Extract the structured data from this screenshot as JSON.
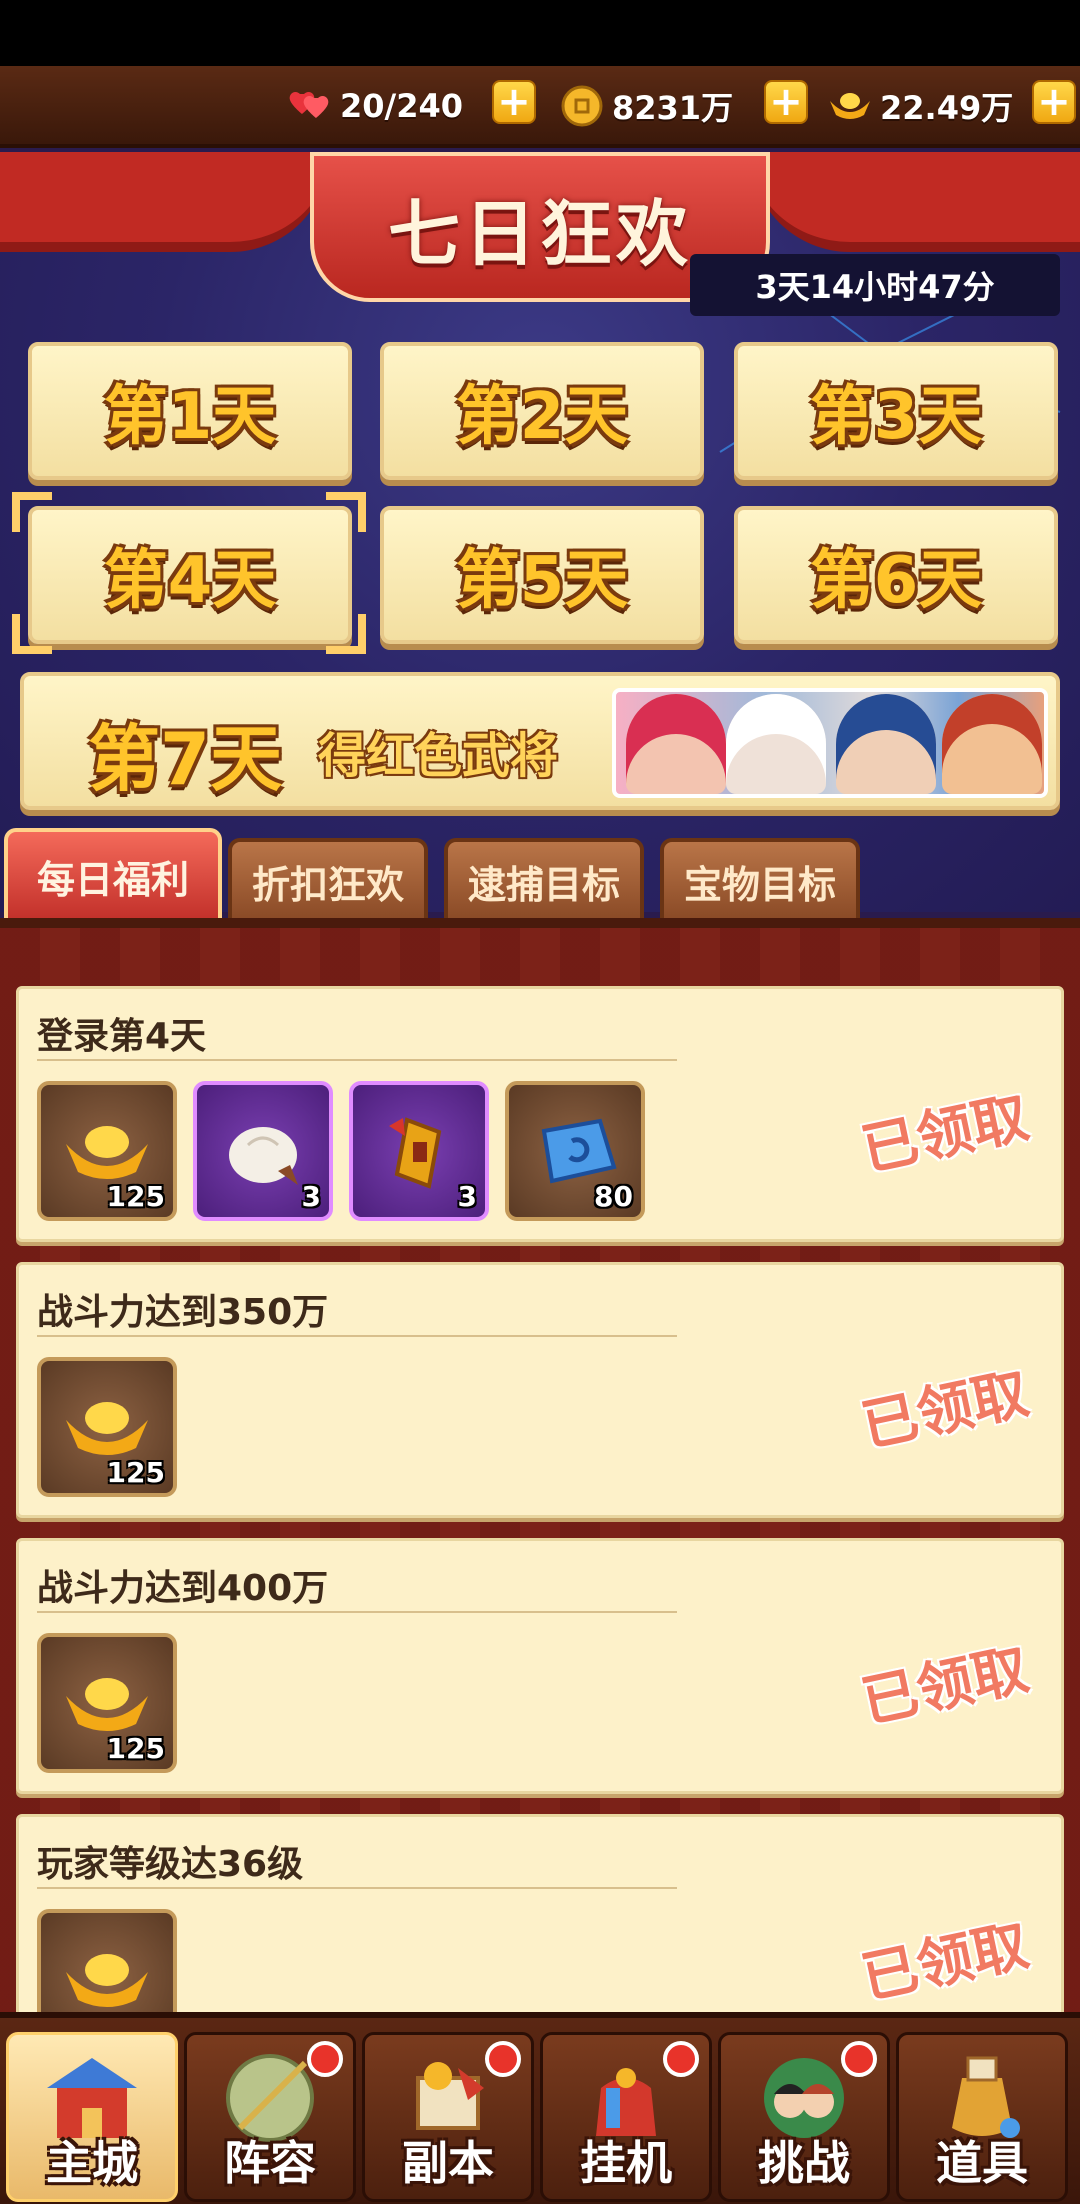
{
  "resources": [
    {
      "icon": "hearts-icon",
      "value": "20/240"
    },
    {
      "icon": "coin-icon",
      "value": "8231万"
    },
    {
      "icon": "ingot-icon",
      "value": "22.49万"
    }
  ],
  "event": {
    "title": "七日狂欢",
    "timer": "3天14小时47分"
  },
  "days": [
    "第1天",
    "第2天",
    "第3天",
    "第4天",
    "第5天",
    "第6天"
  ],
  "selected_day": "第4天",
  "day7": {
    "label": "第7天",
    "desc": "得红色武将"
  },
  "tabs": [
    "每日福利",
    "折扣狂欢",
    "逮捕目标",
    "宝物目标"
  ],
  "active_tab": "每日福利",
  "tasks": [
    {
      "title": "登录第4天",
      "status": "已领取",
      "rewards": [
        {
          "icon": "gold-ingot-icon",
          "count": "125",
          "rarity": "normal"
        },
        {
          "icon": "steamed-bun-icon",
          "count": "3",
          "rarity": "purple"
        },
        {
          "icon": "token-plaque-icon",
          "count": "3",
          "rarity": "purple"
        },
        {
          "icon": "blue-stone-icon",
          "count": "80",
          "rarity": "normal"
        }
      ]
    },
    {
      "title": "战斗力达到350万",
      "status": "已领取",
      "rewards": [
        {
          "icon": "gold-ingot-icon",
          "count": "125",
          "rarity": "normal"
        }
      ]
    },
    {
      "title": "战斗力达到400万",
      "status": "已领取",
      "rewards": [
        {
          "icon": "gold-ingot-icon",
          "count": "125",
          "rarity": "normal"
        }
      ]
    },
    {
      "title": "玩家等级达36级",
      "status": "已领取",
      "rewards": [
        {
          "icon": "gold-ingot-icon",
          "count": "",
          "rarity": "normal"
        }
      ]
    }
  ],
  "nav": [
    {
      "label": "主城",
      "icon": "palace-icon",
      "badge": false,
      "active": true
    },
    {
      "label": "阵容",
      "icon": "shield-icon",
      "badge": true,
      "active": false
    },
    {
      "label": "副本",
      "icon": "scroll-icon",
      "badge": true,
      "active": false
    },
    {
      "label": "挂机",
      "icon": "bag-icon",
      "badge": true,
      "active": false
    },
    {
      "label": "挑战",
      "icon": "heroes-icon",
      "badge": true,
      "active": false
    },
    {
      "label": "道具",
      "icon": "jar-icon",
      "badge": false,
      "active": false
    }
  ],
  "colors": {
    "accent": "#c12a23",
    "gold": "#ffc42b",
    "claimed": "#f17a62"
  }
}
